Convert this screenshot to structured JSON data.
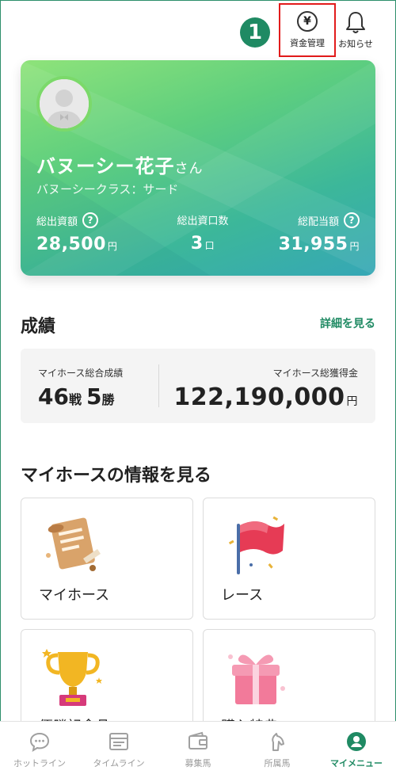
{
  "header": {
    "step_number": "1",
    "fund_label": "資金管理",
    "fund_icon": "¥",
    "notice_label": "お知らせ"
  },
  "profile": {
    "name": "バヌーシー花子",
    "name_suffix": "さん",
    "class_label": "バヌーシークラス：サード",
    "stats": [
      {
        "label": "総出資額",
        "value": "28,500",
        "unit": "円",
        "help": true
      },
      {
        "label": "総出資口数",
        "value": "3",
        "unit": "口",
        "help": false
      },
      {
        "label": "総配当額",
        "value": "31,955",
        "unit": "円",
        "help": true
      }
    ]
  },
  "results": {
    "title": "成績",
    "detail_link": "詳細を見る",
    "left_label": "マイホース総合成績",
    "races": "46",
    "races_unit": "戦",
    "wins": "5",
    "wins_unit": "勝",
    "right_label": "マイホース総獲得金",
    "earnings": "122,190,000",
    "earnings_unit": "円"
  },
  "info": {
    "title": "マイホースの情報を見る",
    "tiles": [
      {
        "label": "マイホース",
        "icon": "scroll-icon"
      },
      {
        "label": "レース",
        "icon": "flag-icon"
      },
      {
        "label": "優勝記念品",
        "icon": "trophy-icon"
      },
      {
        "label": "購入特典",
        "icon": "gift-icon"
      }
    ]
  },
  "bottom_nav": [
    {
      "label": "ホットライン",
      "icon": "chat-icon",
      "active": false
    },
    {
      "label": "タイムライン",
      "icon": "timeline-icon",
      "active": false
    },
    {
      "label": "募集馬",
      "icon": "wallet-icon",
      "active": false
    },
    {
      "label": "所属馬",
      "icon": "horse-icon",
      "active": false
    },
    {
      "label": "マイメニュー",
      "icon": "user-icon",
      "active": true
    }
  ],
  "colors": {
    "accent": "#1f8a63",
    "highlight": "#e21b1b"
  }
}
